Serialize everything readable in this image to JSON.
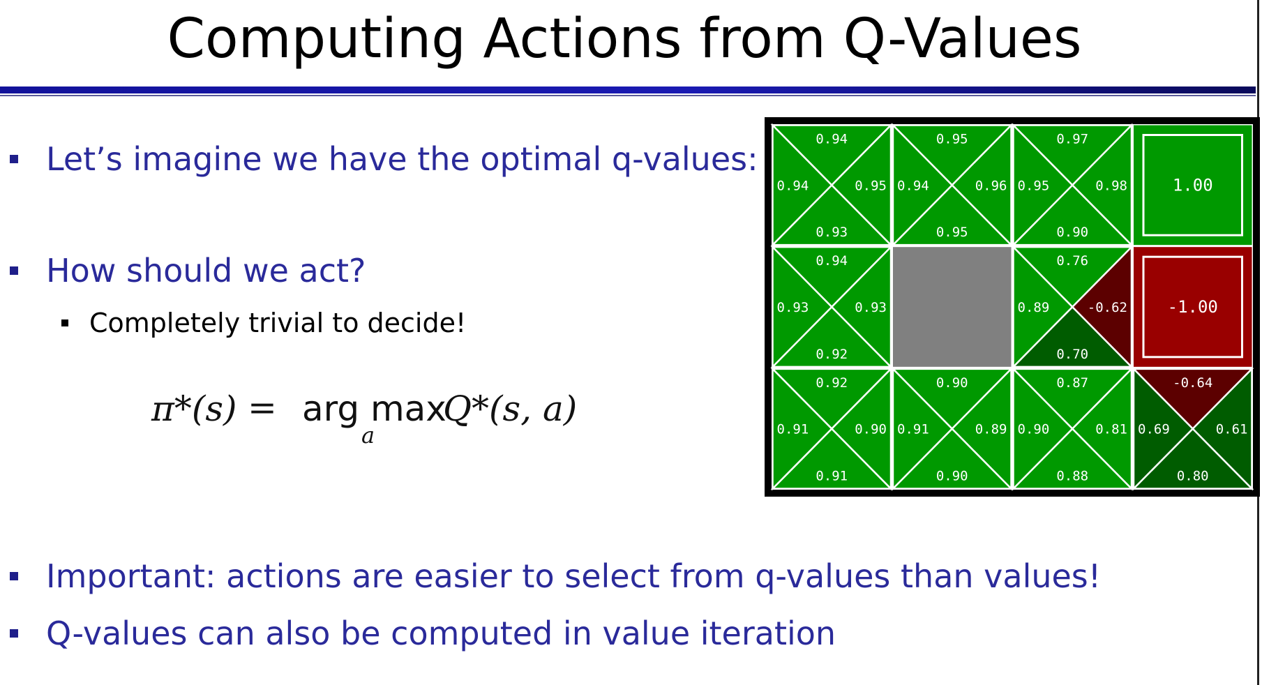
{
  "title": "Computing Actions from Q-Values",
  "bullets": {
    "b1": "Let’s imagine we have the optimal q-values:",
    "b2": "How should we act?",
    "b2_sub": "Completely trivial to decide!",
    "b3": "Important: actions are easier to select from q-values than values!",
    "b4": "Q-values can also be computed in value iteration"
  },
  "formula": {
    "lhs": "π*(s)",
    "equals": "=",
    "operator": "arg max",
    "subscript": "a",
    "rhs": "Q*(s, a)"
  },
  "gridworld": {
    "rows": 3,
    "cols": 4,
    "colors": {
      "frame": "#000000",
      "line": "#ffffff",
      "green": "#009900",
      "dark_green": "#005c00",
      "red": "#990000",
      "dark_red": "#5c0000",
      "wall": "#808080"
    },
    "cells": [
      {
        "row": 0,
        "col": 0,
        "type": "q",
        "values": {
          "north": "0.94",
          "west": "0.94",
          "east": "0.95",
          "south": "0.93"
        },
        "shades": {
          "north": "green",
          "west": "green",
          "east": "green",
          "south": "green"
        }
      },
      {
        "row": 0,
        "col": 1,
        "type": "q",
        "values": {
          "north": "0.95",
          "west": "0.94",
          "east": "0.96",
          "south": "0.95"
        },
        "shades": {
          "north": "green",
          "west": "green",
          "east": "green",
          "south": "green"
        }
      },
      {
        "row": 0,
        "col": 2,
        "type": "q",
        "values": {
          "north": "0.97",
          "west": "0.95",
          "east": "0.98",
          "south": "0.90"
        },
        "shades": {
          "north": "green",
          "west": "green",
          "east": "green",
          "south": "green"
        }
      },
      {
        "row": 0,
        "col": 3,
        "type": "terminal",
        "value": "1.00",
        "shade": "green"
      },
      {
        "row": 1,
        "col": 0,
        "type": "q",
        "values": {
          "north": "0.94",
          "west": "0.93",
          "east": "0.93",
          "south": "0.92"
        },
        "shades": {
          "north": "green",
          "west": "green",
          "east": "green",
          "south": "green"
        }
      },
      {
        "row": 1,
        "col": 1,
        "type": "wall"
      },
      {
        "row": 1,
        "col": 2,
        "type": "q",
        "values": {
          "north": "0.76",
          "west": "0.89",
          "east": "-0.62",
          "south": "0.70"
        },
        "shades": {
          "north": "green",
          "west": "green",
          "east": "dark_red",
          "south": "dark_green"
        }
      },
      {
        "row": 1,
        "col": 3,
        "type": "terminal",
        "value": "-1.00",
        "shade": "red"
      },
      {
        "row": 2,
        "col": 0,
        "type": "q",
        "values": {
          "north": "0.92",
          "west": "0.91",
          "east": "0.90",
          "south": "0.91"
        },
        "shades": {
          "north": "green",
          "west": "green",
          "east": "green",
          "south": "green"
        }
      },
      {
        "row": 2,
        "col": 1,
        "type": "q",
        "values": {
          "north": "0.90",
          "west": "0.91",
          "east": "0.89",
          "south": "0.90"
        },
        "shades": {
          "north": "green",
          "west": "green",
          "east": "green",
          "south": "green"
        }
      },
      {
        "row": 2,
        "col": 2,
        "type": "q",
        "values": {
          "north": "0.87",
          "west": "0.90",
          "east": "0.81",
          "south": "0.88"
        },
        "shades": {
          "north": "green",
          "west": "green",
          "east": "green",
          "south": "green"
        }
      },
      {
        "row": 2,
        "col": 3,
        "type": "q",
        "values": {
          "north": "-0.64",
          "west": "0.69",
          "east": "0.61",
          "south": "0.80"
        },
        "shades": {
          "north": "dark_red",
          "west": "dark_green",
          "east": "dark_green",
          "south": "dark_green"
        }
      }
    ]
  }
}
